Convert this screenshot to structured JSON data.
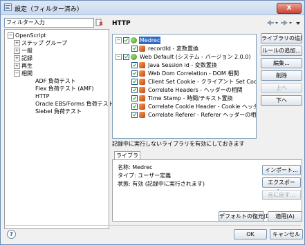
{
  "window": {
    "title": "設定（フィルター済み）",
    "close_label": "X"
  },
  "filter": {
    "value": "フィルター入力"
  },
  "tree": {
    "items": [
      {
        "label": "OpenScript",
        "level": 0,
        "expander": "−"
      },
      {
        "label": "ステップ グループ",
        "level": 1,
        "expander": "+"
      },
      {
        "label": "一般",
        "level": 1,
        "expander": "+"
      },
      {
        "label": "記録",
        "level": 1,
        "expander": "+"
      },
      {
        "label": "再生",
        "level": 1,
        "expander": "+"
      },
      {
        "label": "相関",
        "level": 1,
        "expander": "−"
      },
      {
        "label": "ADF 負荷テスト",
        "level": 2,
        "expander": ""
      },
      {
        "label": "Flex 負荷テスト (AMF)",
        "level": 2,
        "expander": ""
      },
      {
        "label": "HTTP",
        "level": 2,
        "expander": ""
      },
      {
        "label": "Oracle EBS/Forms 負荷テスト",
        "level": 2,
        "expander": ""
      },
      {
        "label": "Siebel 負荷テスト",
        "level": 2,
        "expander": ""
      }
    ]
  },
  "page": {
    "title": "HTTP"
  },
  "libraries": {
    "rows": [
      {
        "label": "Medrec",
        "level": 0,
        "expander": "−",
        "selected": true
      },
      {
        "label": "recordId - 変数置換",
        "level": 1,
        "expander": "",
        "selected": false
      },
      {
        "label": "Web Default (システム - バージョン 2.0.0)",
        "level": 0,
        "expander": "−",
        "selected": false
      },
      {
        "label": "Java Session id - 変数置換",
        "level": 1,
        "expander": "",
        "selected": false
      },
      {
        "label": "Web Dom Correlation - DOM 相関",
        "level": 1,
        "expander": "",
        "selected": false
      },
      {
        "label": "Client Set Cookie - クライアント Set Cookie",
        "level": 1,
        "expander": "",
        "selected": false
      },
      {
        "label": "Correlate Headers - ヘッダーの相関",
        "level": 1,
        "expander": "",
        "selected": false
      },
      {
        "label": "Time Stamp - 時間/テキスト置換",
        "level": 1,
        "expander": "",
        "selected": false
      },
      {
        "label": "Correlate Cookie Header - Cookie ヘッダーの相",
        "level": 1,
        "expander": "",
        "selected": false
      },
      {
        "label": "Correlate Referer - Referer ヘッダーの相関",
        "level": 1,
        "expander": "",
        "selected": false
      }
    ]
  },
  "side_buttons": {
    "add_library": "ライブラリの追加...",
    "add_rule": "ルールの追加...",
    "edit": "編集...",
    "delete": "削除",
    "up": "上へ",
    "down": "下へ"
  },
  "enable_checkbox": {
    "label": "記録中に実行しないライブラリを有効にしておきます"
  },
  "tab": {
    "label": "ライブラリ"
  },
  "info": {
    "name": "名称: Medrec",
    "type": "タイプ: ユーザー定義",
    "status": "状態: 有効 (記録中に実行されます)"
  },
  "panel_buttons": {
    "import": "インポート...",
    "export": "エクスポート...",
    "restore": "元に戻す..."
  },
  "footer": {
    "restore_defaults": "デフォルトの復元(D)",
    "apply": "適用(A)",
    "ok": "OK",
    "cancel": "キャンセル"
  },
  "colors": {
    "accent": "#316ac5",
    "check": "#21a121"
  }
}
